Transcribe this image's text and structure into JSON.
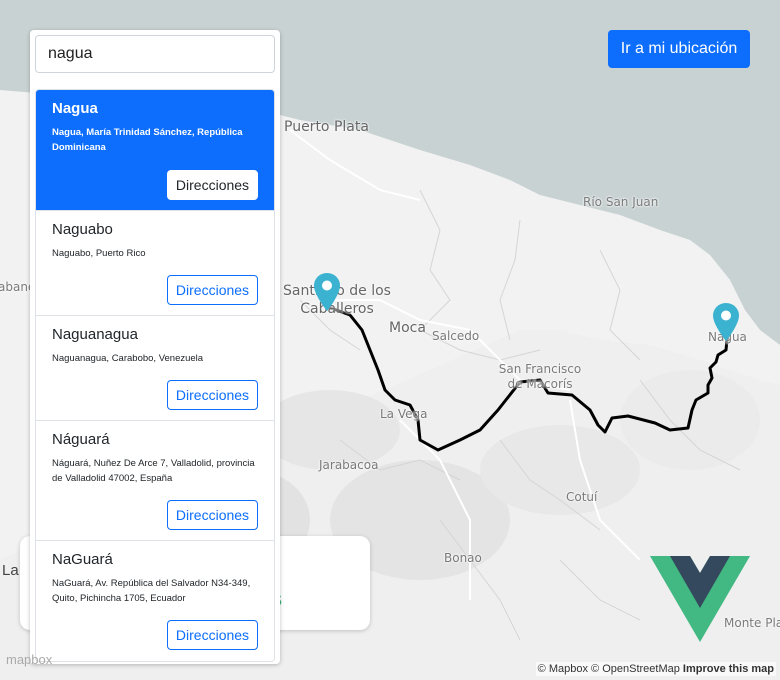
{
  "search": {
    "value": "nagua"
  },
  "locate_button": "Ir a mi ubicación",
  "results": [
    {
      "title": "Nagua",
      "address": "Nagua, María Trinidad Sánchez, República Dominicana",
      "button": "Direcciones",
      "active": true
    },
    {
      "title": "Naguabo",
      "address": "Naguabo, Puerto Rico",
      "button": "Direcciones",
      "active": false
    },
    {
      "title": "Naguanagua",
      "address": "Naguanagua, Carabobo, Venezuela",
      "button": "Direcciones",
      "active": false
    },
    {
      "title": "Náguará",
      "address": "Náguará, Nuñez De Arce 7, Valladolid, provincia de Valladolid 47002, España",
      "button": "Direcciones",
      "active": false
    },
    {
      "title": "NaGuará",
      "address": "NaGuará, Av. República del Salvador N34-349, Quito, Pichincha 1705, Ecuador",
      "button": "Direcciones",
      "active": false
    }
  ],
  "map": {
    "places": {
      "puerto_plata": "Puerto Plata",
      "rio_san_juan": "Río San Juan",
      "santiago": "Santiago de los Caballeros",
      "moca": "Moca",
      "salcedo": "Salcedo",
      "san_francisco": "San Francisco de Macorís",
      "la_vega": "La Vega",
      "jarabacoa": "Jarabacoa",
      "cotui": "Cotuí",
      "bonao": "Bonao",
      "monte_plata": "Monte Plata",
      "nagua": "Nagua",
      "left_edge": "abane",
      "left_edge2": "La"
    },
    "route_color": "#000000",
    "pin_color": "#3bb2d0"
  },
  "attribution": {
    "mapbox": "© Mapbox",
    "osm": "© OpenStreetMap",
    "improve": "Improve this map"
  },
  "mapbox_logo": "mapbox",
  "colors": {
    "accent": "#0d6efd",
    "vue_green": "#42b883",
    "vue_dark": "#35495e"
  }
}
